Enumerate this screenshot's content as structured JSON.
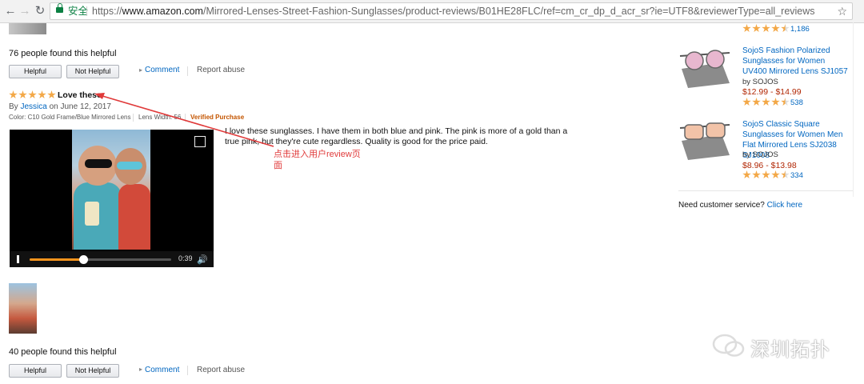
{
  "browser": {
    "secure_label": "安全",
    "url_scheme": "https://",
    "url_host": "www.amazon.com",
    "url_path": "/Mirrored-Lenses-Street-Fashion-Sunglasses/product-reviews/B01HE28FLC/ref=cm_cr_dp_d_acr_sr?ie=UTF8&reviewerType=all_reviews"
  },
  "review1": {
    "helpful_text": "76 people found this helpful",
    "helpful_btn": "Helpful",
    "not_helpful_btn": "Not Helpful",
    "comment": "Comment",
    "report": "Report abuse"
  },
  "review2": {
    "rating": 5,
    "title": "Love these",
    "by": "By",
    "author": "Jessica",
    "date": "on June 12, 2017",
    "color_label": "Color: C10 Gold Frame/Blue Mirrored Lens",
    "lens_label": "Lens Width: 56",
    "verified": "Verified Purchase",
    "body": "I love these sunglasses. I have them in both blue and pink. The pink is more of a gold than a true pink, but they're cute regardless. Quality is good for the price paid.",
    "video_time": "0:39",
    "video_progress": 0.38,
    "annotation": "点击进入用户review页面",
    "helpful_text": "40 people found this helpful",
    "helpful_btn": "Helpful",
    "not_helpful_btn": "Not Helpful",
    "comment": "Comment",
    "report": "Report abuse"
  },
  "sidebar": {
    "top_count": "1,186",
    "products": [
      {
        "title": "SojoS Fashion Polarized Sunglasses for Women UV400 Mirrored Lens SJ1057",
        "brand": "by SOJOS",
        "price": "$12.99 - $14.99",
        "rating": 4.5,
        "count": "538",
        "lens_color": "#e8b7cf"
      },
      {
        "title": "SojoS Classic Square Sunglasses for Women Men Flat Mirrored Lens SJ2038 SJ1008",
        "brand": "by SOJOS",
        "price": "$8.96 - $13.98",
        "rating": 4.5,
        "count": "334",
        "lens_color": "#f2c3a8"
      }
    ],
    "service_text": "Need customer service?",
    "service_link": "Click here"
  },
  "watermark": "深圳拓扑",
  "colors": {
    "link": "#0066c0",
    "star": "#f3a847",
    "price": "#b12704",
    "verified": "#c45500",
    "annotation": "#e03a3a"
  }
}
